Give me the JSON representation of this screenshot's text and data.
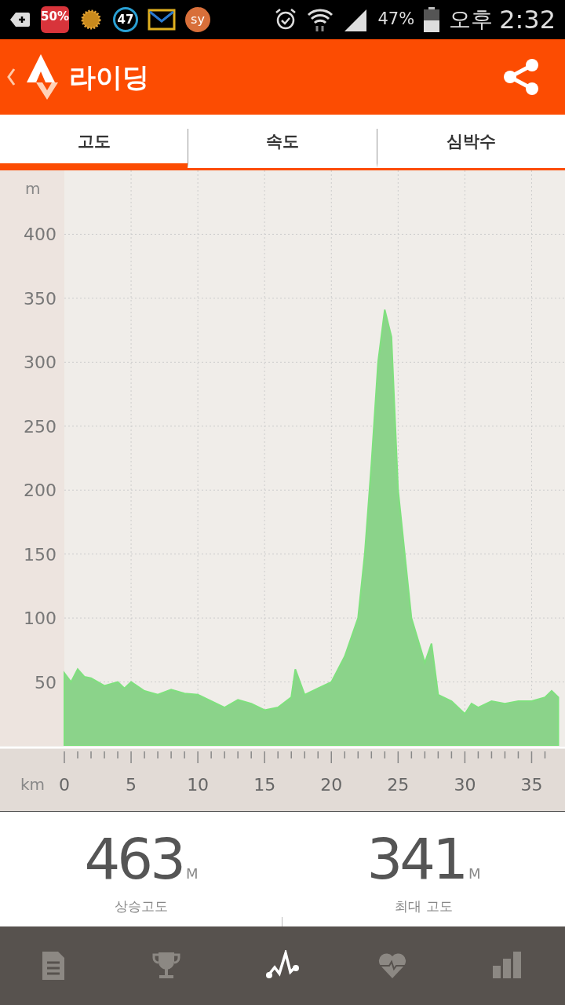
{
  "status_bar": {
    "badge_sale": "50%",
    "badge_count": "47",
    "badge_app": "sy",
    "battery": "47%",
    "ampm": "오후",
    "time": "2:32"
  },
  "app_bar": {
    "title": "라이딩"
  },
  "tabs": [
    {
      "label": "고도",
      "selected": true
    },
    {
      "label": "속도",
      "selected": false
    },
    {
      "label": "심박수",
      "selected": false
    }
  ],
  "chart": {
    "chart_data": {
      "type": "area",
      "xlabel": "km",
      "ylabel": "m",
      "x": [
        0,
        0.5,
        1,
        1.5,
        2,
        3,
        4,
        4.5,
        5,
        6,
        7,
        8,
        9,
        10,
        11,
        12,
        13,
        14,
        15,
        16,
        17,
        17.3,
        18,
        19,
        20,
        21,
        22,
        22.5,
        23,
        23.5,
        24,
        24.5,
        25,
        26,
        27,
        27.5,
        28,
        29,
        30,
        30.5,
        31,
        32,
        33,
        34,
        35,
        36,
        36.5,
        37
      ],
      "series": [
        {
          "color": "#8bd38a",
          "values": [
            57,
            50,
            60,
            54,
            53,
            47,
            50,
            45,
            50,
            43,
            40,
            44,
            41,
            40,
            35,
            30,
            36,
            33,
            28,
            30,
            38,
            60,
            40,
            45,
            50,
            70,
            100,
            150,
            220,
            300,
            341,
            320,
            200,
            100,
            65,
            80,
            40,
            35,
            25,
            33,
            30,
            35,
            33,
            35,
            35,
            38,
            43,
            38
          ]
        }
      ],
      "grid": true,
      "xlim": [
        0,
        37.5
      ],
      "ylim": [
        0,
        450
      ],
      "xticks": [
        0,
        5,
        10,
        15,
        20,
        25,
        30,
        35
      ],
      "yticks": [
        50,
        100,
        150,
        200,
        250,
        300,
        350,
        400
      ]
    }
  },
  "stats": [
    {
      "value": "463",
      "unit": "M",
      "label": "상승고도"
    },
    {
      "value": "341",
      "unit": "M",
      "label": "최대 고도"
    }
  ],
  "bottom_nav": [
    {
      "kind": "summary",
      "selected": false
    },
    {
      "kind": "trophy",
      "selected": false
    },
    {
      "kind": "elevation",
      "selected": true
    },
    {
      "kind": "heart",
      "selected": false
    },
    {
      "kind": "stats",
      "selected": false
    }
  ]
}
